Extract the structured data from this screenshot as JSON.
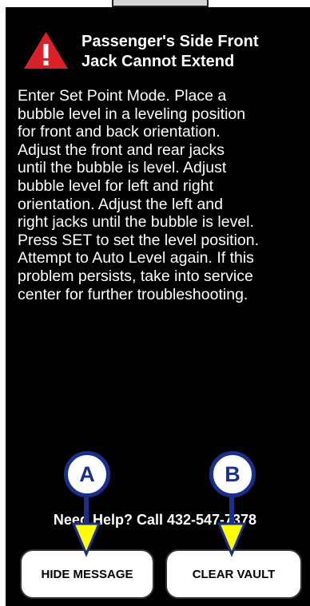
{
  "alert": {
    "icon": "warning-triangle-icon",
    "title_line1": "Passenger's Side Front",
    "title_line2": "Jack Cannot Extend",
    "body_lines": [
      "Enter Set Point Mode. Place a",
      "bubble level in a leveling position",
      "for front and back orientation.",
      "Adjust the front and rear jacks",
      "until the bubble is level. Adjust",
      "bubble level for left and right",
      "orientation. Adjust the left and",
      "right jacks until the bubble is level.",
      "Press SET to set the level position.",
      "Attempt to Auto Level again. If this",
      "problem persists, take into service",
      "center for further troubleshooting."
    ]
  },
  "help_text": "Need Help? Call 432-547-7378",
  "buttons": {
    "hide_label": "HIDE MESSAGE",
    "clear_label": "CLEAR VAULT"
  },
  "callouts": {
    "a": "A",
    "b": "B"
  },
  "colors": {
    "warning_red": "#d9202b",
    "callout_blue": "#1a2f8c",
    "arrow_yellow": "#ffff00"
  }
}
